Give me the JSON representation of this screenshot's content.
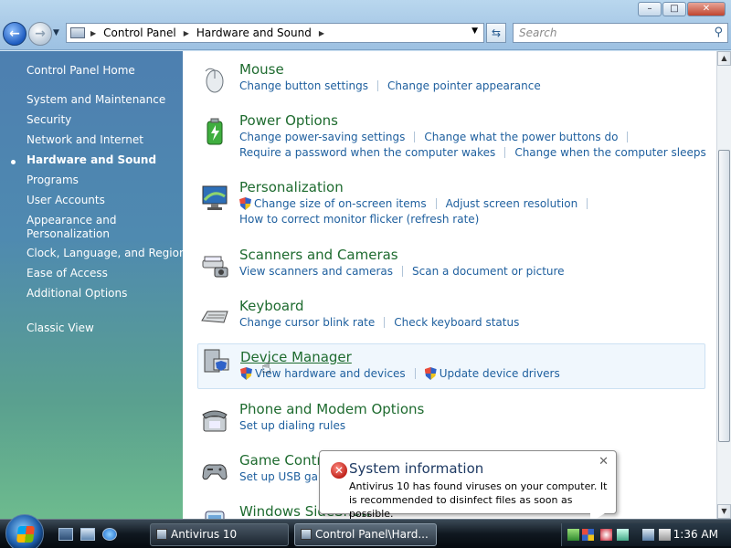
{
  "window": {
    "minimize": "–",
    "maximize": "□",
    "close": "✕"
  },
  "address": {
    "segments": [
      "Control Panel",
      "Hardware and Sound"
    ],
    "search_placeholder": "Search"
  },
  "sidebar": {
    "items": [
      {
        "label": "Control Panel Home"
      },
      {
        "label": "System and Maintenance"
      },
      {
        "label": "Security"
      },
      {
        "label": "Network and Internet"
      },
      {
        "label": "Hardware and Sound",
        "active": true
      },
      {
        "label": "Programs"
      },
      {
        "label": "User Accounts"
      },
      {
        "label": "Appearance and"
      },
      {
        "label": "Personalization"
      },
      {
        "label": "Clock, Language, and Region"
      },
      {
        "label": "Ease of Access"
      },
      {
        "label": "Additional Options"
      },
      {
        "label": "Classic View"
      }
    ]
  },
  "categories": [
    {
      "title": "Mouse",
      "icon": "mouse-icon",
      "links": [
        [
          "Change button settings",
          "Change pointer appearance"
        ]
      ]
    },
    {
      "title": "Power Options",
      "icon": "battery-icon",
      "links": [
        [
          "Change power-saving settings",
          "Change what the power buttons do"
        ],
        [
          "Require a password when the computer wakes",
          "Change when the computer sleeps"
        ]
      ]
    },
    {
      "title": "Personalization",
      "icon": "monitor-icon",
      "links": [
        [
          "Change size of on-screen items",
          "Adjust screen resolution"
        ],
        [
          "How to correct monitor flicker (refresh rate)"
        ]
      ]
    },
    {
      "title": "Scanners and Cameras",
      "icon": "scanner-icon",
      "links": [
        [
          "View scanners and cameras",
          "Scan a document or picture"
        ]
      ]
    },
    {
      "title": "Keyboard",
      "icon": "keyboard-icon",
      "links": [
        [
          "Change cursor blink rate",
          "Check keyboard status"
        ]
      ]
    },
    {
      "title": "Device Manager",
      "icon": "device-manager-icon",
      "links": [
        [
          "View hardware and devices",
          "Update device drivers"
        ]
      ]
    },
    {
      "title": "Phone and Modem Options",
      "icon": "phone-icon",
      "links": [
        [
          "Set up dialing rules"
        ]
      ]
    },
    {
      "title": "Game Controllers",
      "icon": "gamepad-icon",
      "links": [
        [
          "Set up USB game controllers"
        ]
      ]
    },
    {
      "title": "Windows SideShow",
      "icon": "sideshow-icon",
      "links": []
    }
  ],
  "balloon": {
    "title": "System information",
    "text": "Antivirus 10 has found viruses on your computer. It is recommended to disinfect files as soon as possible.",
    "close": "✕"
  },
  "taskbar": {
    "tasks": [
      {
        "label": "Antivirus 10",
        "active": false
      },
      {
        "label": "Control Panel\\Hard...",
        "active": true
      }
    ],
    "clock": "1:36 AM"
  },
  "colors": {
    "link": "#1e5f9e",
    "category_title": "#1e6b2f",
    "sidebar_top": "#4d7fb0",
    "sidebar_bottom": "#6dbb8e"
  }
}
